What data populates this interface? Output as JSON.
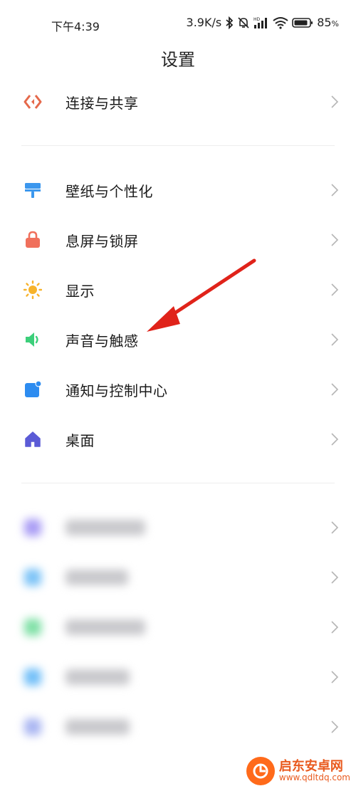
{
  "status_bar": {
    "time": "下午4:39",
    "net_speed": "3.9K/s",
    "battery": "85",
    "battery_unit": "%",
    "icons": [
      "bluetooth-icon",
      "mute-bell-icon",
      "hd-signal-icon",
      "wifi-icon",
      "battery-icon"
    ]
  },
  "header": {
    "title": "设置"
  },
  "group1": [
    {
      "label": "连接与共享",
      "icon": "share-icon",
      "color": "#e5694b"
    }
  ],
  "group2": [
    {
      "label": "壁纸与个性化",
      "icon": "brush-icon",
      "color": "#3b97ee"
    },
    {
      "label": "息屏与锁屏",
      "icon": "lock-icon",
      "color": "#f0705c"
    },
    {
      "label": "显示",
      "icon": "sun-icon",
      "color": "#f7b32b"
    },
    {
      "label": "声音与触感",
      "icon": "speaker-icon",
      "color": "#3ccf7a"
    },
    {
      "label": "通知与控制中心",
      "icon": "notification-icon",
      "color": "#2d8cf0"
    },
    {
      "label": "桌面",
      "icon": "home-icon",
      "color": "#5b5bd6"
    }
  ],
  "group3_blurred_colors": [
    "#a99cf5",
    "#7cc3f7",
    "#7fe0a6",
    "#72bff8",
    "#aab6f2"
  ],
  "colors": {
    "arrow": "#e0231a",
    "chevron": "#b5b5b5",
    "divider": "#eeeeee"
  },
  "watermark": {
    "name": "启东安卓网",
    "url": "www.qdltdq.com"
  }
}
